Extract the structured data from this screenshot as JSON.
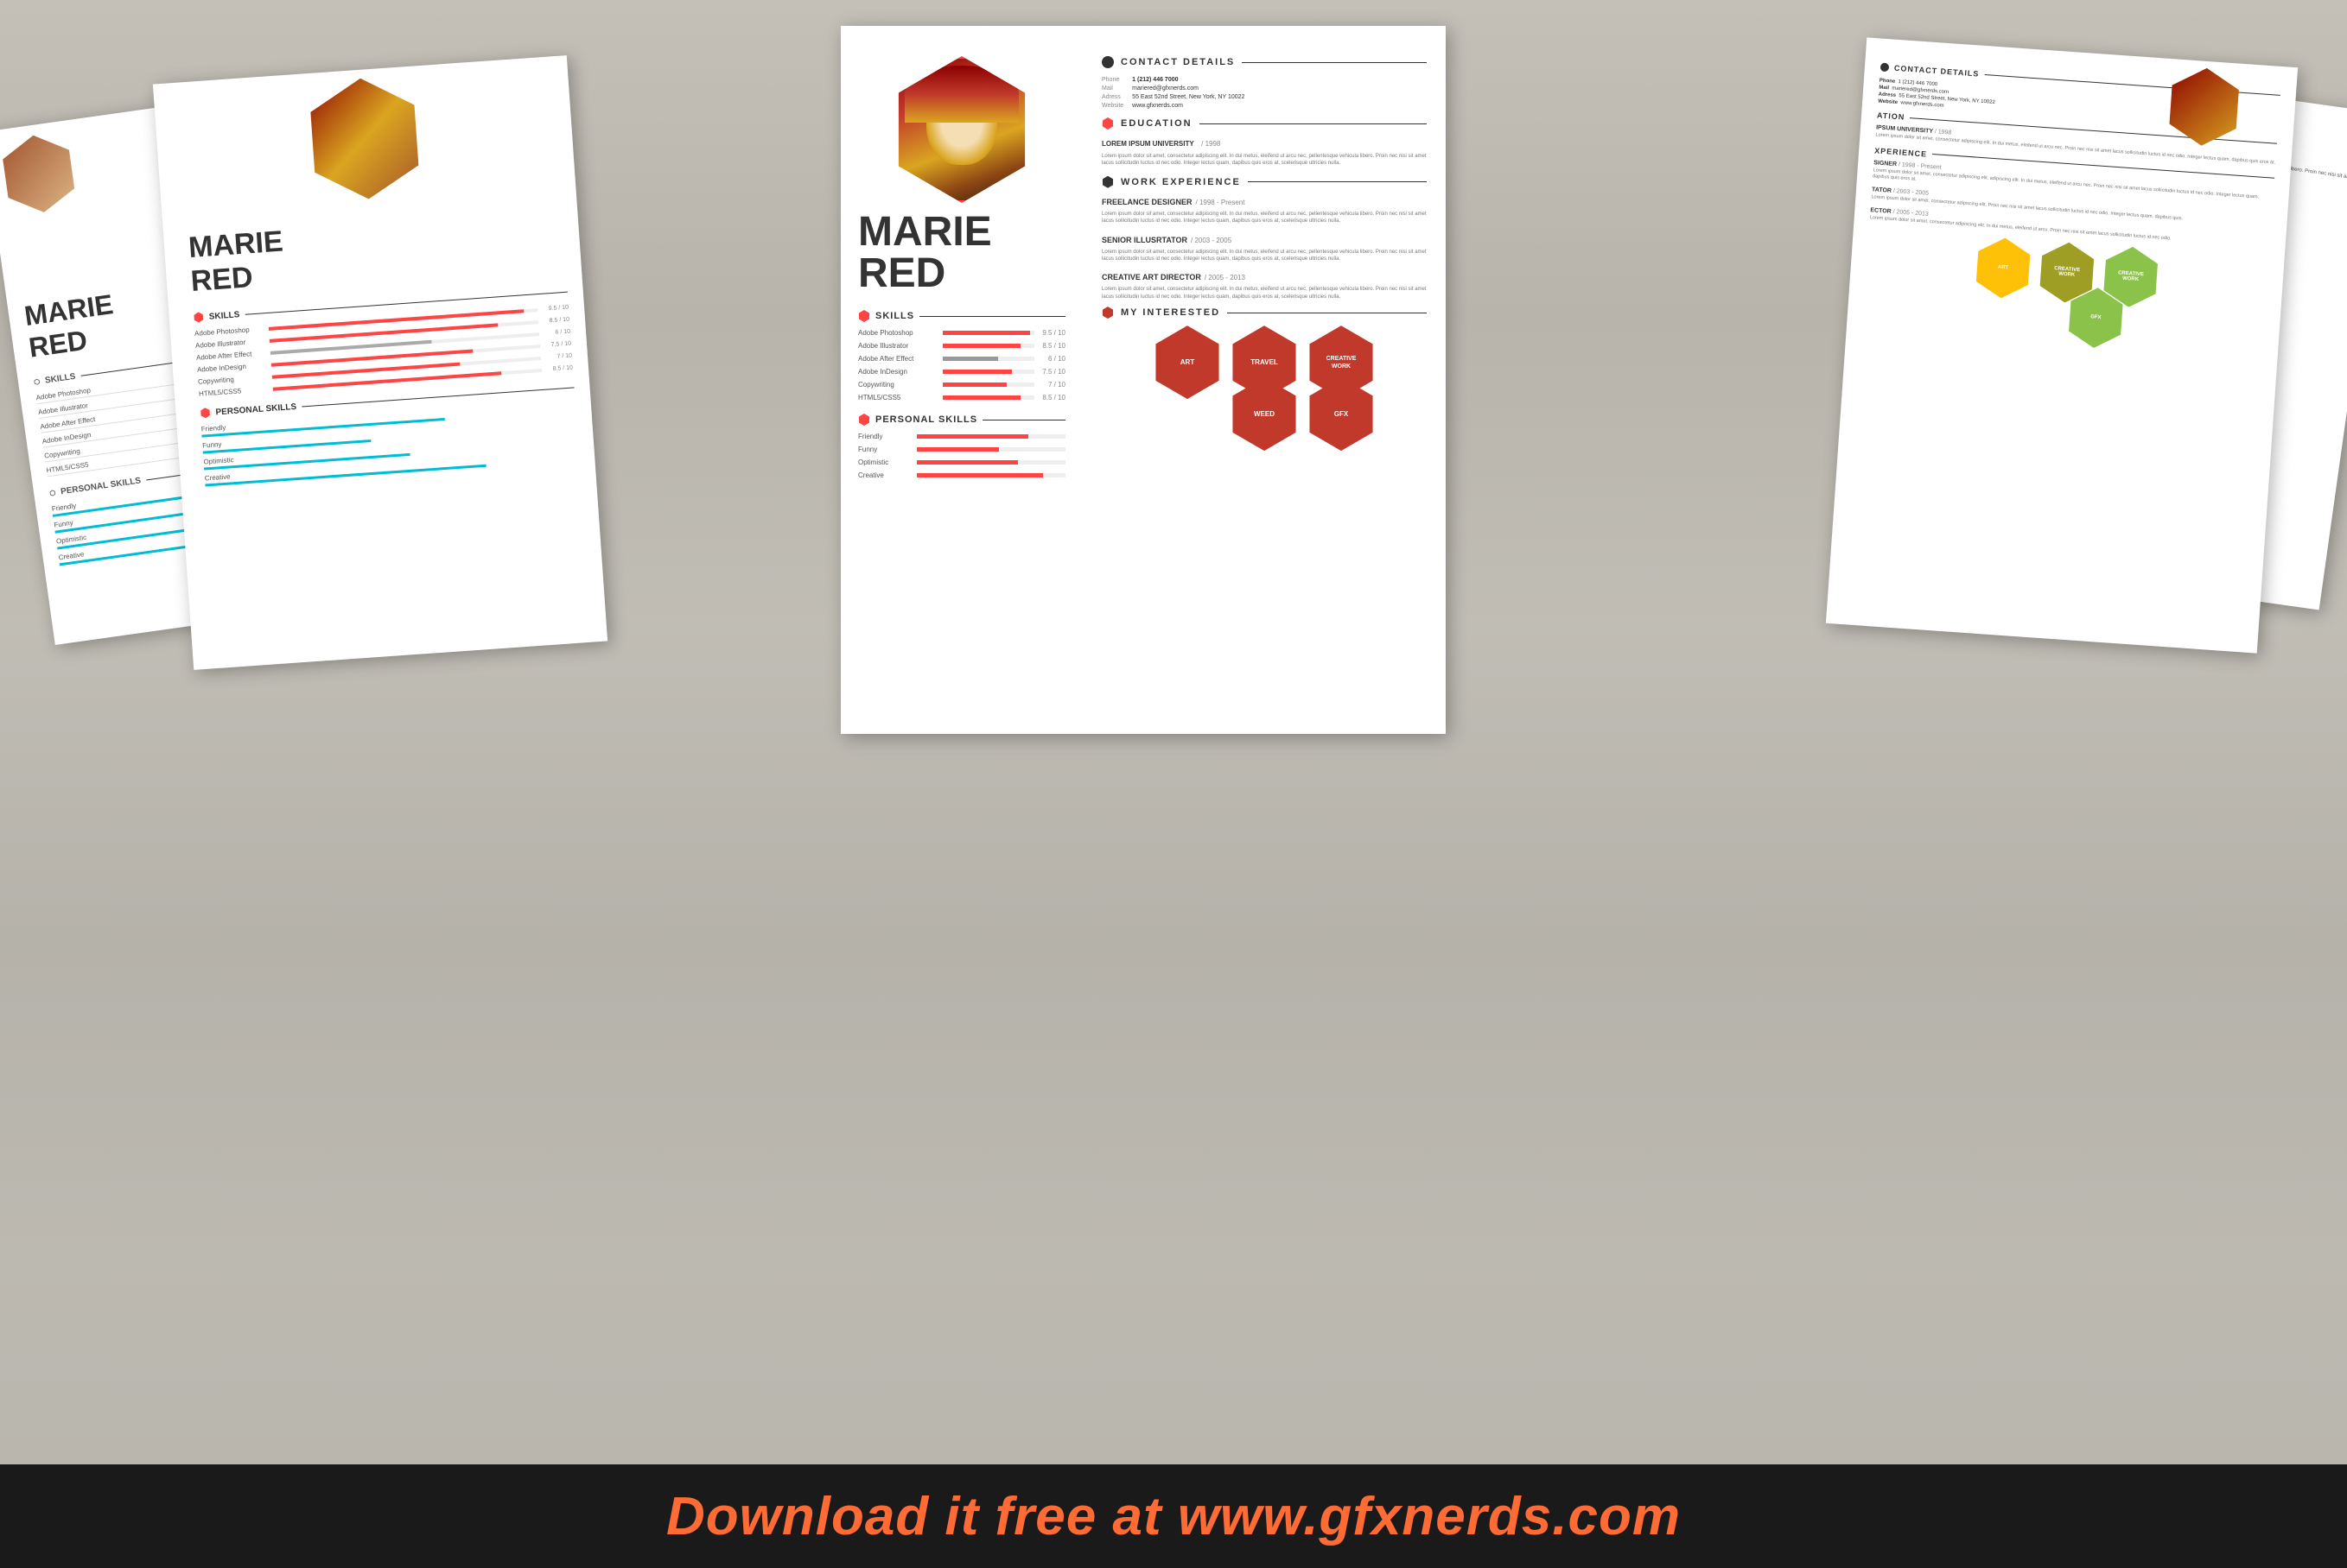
{
  "banner": {
    "text": "Download it free at www.gfxnerds.com"
  },
  "person": {
    "name_line1": "MARIE",
    "name_line2": "RED",
    "photo_alt": "Marie Red portrait"
  },
  "contact": {
    "label": "CONTACT DETAILS",
    "phone_label": "Phone",
    "phone_value": "1 (212) 446 7000",
    "mail_label": "Mail",
    "mail_value": "mariered@gfxnerds.com",
    "address_label": "Adress",
    "address_value": "55 East 52nd Street, New York, NY 10022",
    "website_label": "Website",
    "website_value": "www.gfxnerds.com"
  },
  "education": {
    "label": "EDUCATION",
    "school": "LOREM IPSUM UNIVERSITY",
    "year": "/ 1998",
    "description": "Lorem ipsum dolor sit amet, consectetur adipiscing elit. In dui metus, eleifend ut arcu nec, pellentesque vehicula libero. Proin nec nisi sit amet lacus sollicitudin luctus id nec odio. Integer lectus quam, dapibus quis eros at, scelerisque ultricies nulla."
  },
  "work_experience": {
    "label": "WORK EXPERIENCE",
    "jobs": [
      {
        "title": "FREELANCE DESIGNER",
        "period": "/ 1998 - Present",
        "description": "Lorem ipsum dolor sit amet, consectetur adipiscing elit. In dui metus, eleifend ut arcu nec, pellentesque vehicula libero. Proin nec nisi sit amet lacus sollicitudin luctus id nec odio. Integer lectus quam, dapibus quis eros at, scelerisque ultricies nulla."
      },
      {
        "title": "SENIOR ILLUSRTATOR",
        "period": "/ 2003 - 2005",
        "description": "Lorem ipsum dolor sit amet, consectetur adipiscing elit. In dui metus, eleifend ut arcu nec, pellentesque vehicula libero. Proin nec nisi sit amet lacus sollicitudin luctus id nec odio. Integer lectus quam, dapibus quis eros at, scelerisque ultricies nulla."
      },
      {
        "title": "CREATIVE ART DIRECTOR",
        "period": "/ 2005 - 2013",
        "description": "Lorem ipsum dolor sit amet, consectetur adipiscing elit. In dui metus, eleifend ut arcu nec, pellentesque vehicula libero. Proin nec nisi sit amet lacus sollicitudin luctus id nec odio. Integer lectus quam, dapibus quis eros at, scelerisque ultricies nulla."
      }
    ]
  },
  "skills": {
    "label": "SKILLS",
    "items": [
      {
        "name": "Adobe Photoshop",
        "score": 9.5,
        "max": 10,
        "pct": 95
      },
      {
        "name": "Adobe Illustrator",
        "score": 8.5,
        "max": 10,
        "pct": 85
      },
      {
        "name": "Adobe After Effect",
        "score": 6,
        "max": 10,
        "pct": 60
      },
      {
        "name": "Adobe InDesign",
        "score": 7.5,
        "max": 10,
        "pct": 75
      },
      {
        "name": "Copywriting",
        "score": 7,
        "max": 10,
        "pct": 70
      },
      {
        "name": "HTML5/CSS5",
        "score": 8.5,
        "max": 10,
        "pct": 85
      }
    ]
  },
  "personal_skills": {
    "label": "PERSONAL SKILLS",
    "items": [
      {
        "name": "Friendly",
        "pct": 80
      },
      {
        "name": "Funny",
        "pct": 60
      },
      {
        "name": "Optimistic",
        "pct": 75
      },
      {
        "name": "Creative",
        "pct": 90
      }
    ]
  },
  "interests": {
    "label": "MY INTERESTED",
    "items": [
      {
        "name": "ART",
        "color": "#c0392b"
      },
      {
        "name": "TRAVEL",
        "color": "#c0392b"
      },
      {
        "name": "CREATIVE\nWORK",
        "color": "#c0392b"
      },
      {
        "name": "WEED",
        "color": "#c0392b"
      },
      {
        "name": "GFX",
        "color": "#c0392b"
      }
    ]
  },
  "watermark": {
    "website": "www.gfxnerds.com"
  }
}
